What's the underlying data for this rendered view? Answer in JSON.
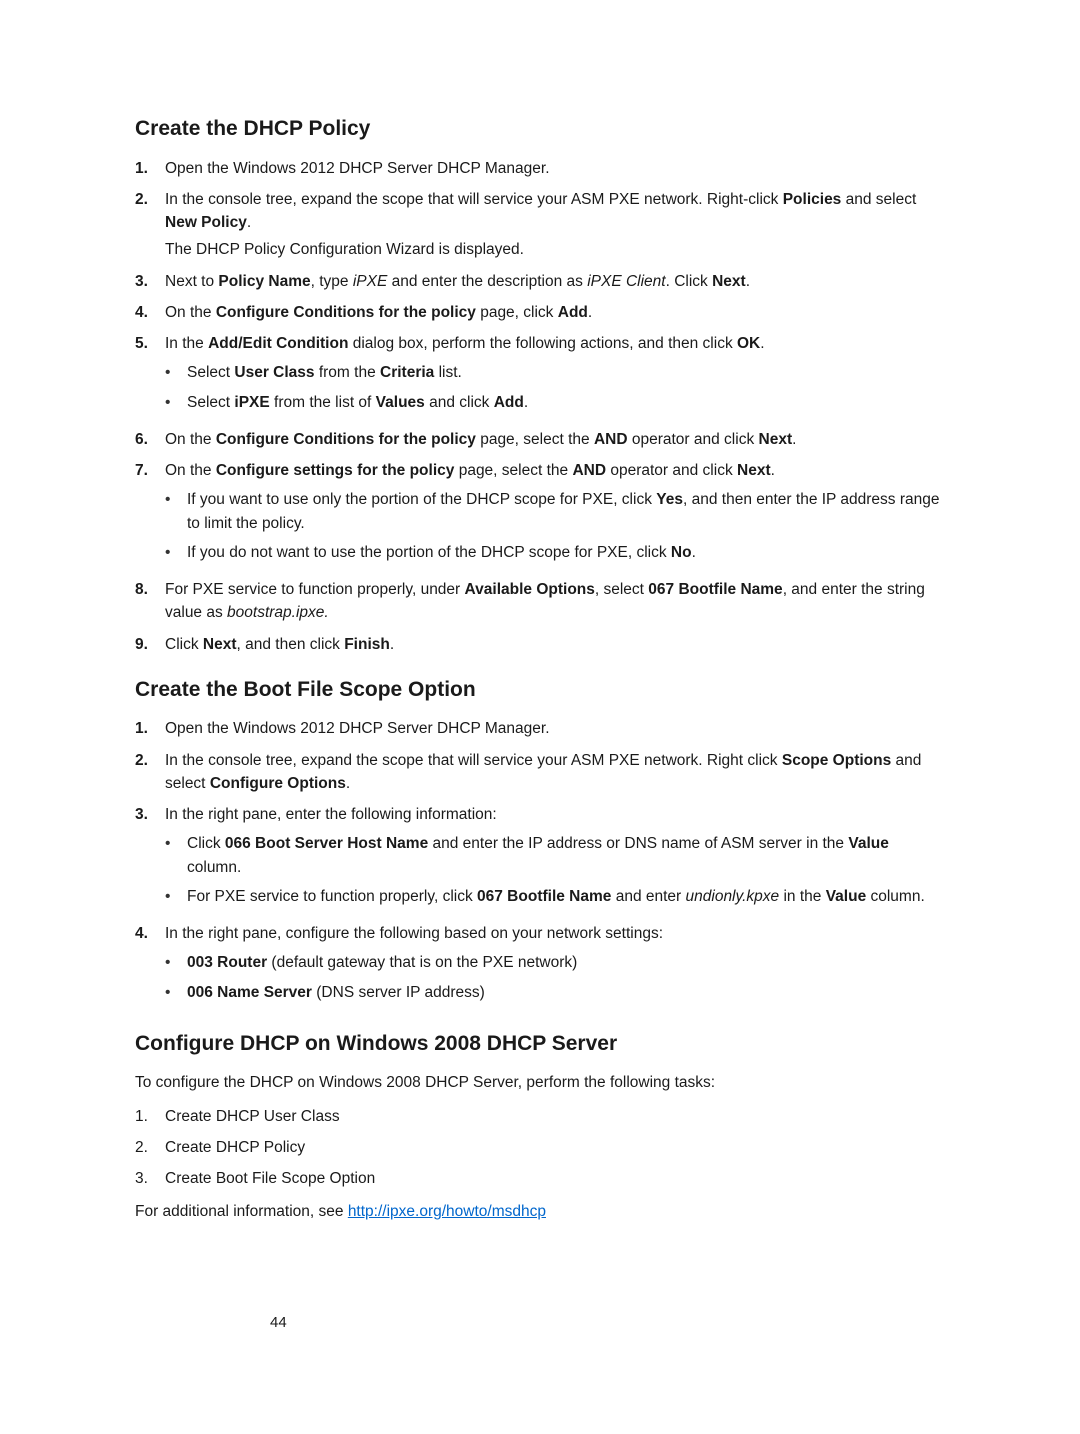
{
  "section1": {
    "heading": "Create the DHCP Policy",
    "items": [
      {
        "num": "1.",
        "html": "Open the Windows 2012 DHCP Server DHCP Manager."
      },
      {
        "num": "2.",
        "html": "In the console tree, expand the scope that will service your ASM PXE network. Right-click <b>Policies</b> and select <b>New Policy</b>.",
        "sub": "The DHCP Policy Configuration Wizard is displayed."
      },
      {
        "num": "3.",
        "html": "Next to <b>Policy Name</b>, type <i>iPXE</i> and enter the description as <i>iPXE Client</i>. Click <b>Next</b>."
      },
      {
        "num": "4.",
        "html": "On the <b>Configure Conditions for the policy</b> page, click <b>Add</b>."
      },
      {
        "num": "5.",
        "html": "In the <b>Add/Edit Condition</b> dialog box, perform the following actions, and then click <b>OK</b>.",
        "bullets": [
          "Select <b>User Class</b> from the <b>Criteria</b> list.",
          "Select <b>iPXE</b> from the list of <b>Values</b> and click <b>Add</b>."
        ]
      },
      {
        "num": "6.",
        "html": "On the <b>Configure Conditions for the policy</b> page, select the <b>AND</b> operator and click <b>Next</b>."
      },
      {
        "num": "7.",
        "html": "On the <b>Configure settings for the policy</b> page, select the <b>AND</b> operator and click <b>Next</b>.",
        "bullets": [
          "If you want to use only the portion of the DHCP scope for PXE, click <b>Yes</b>, and then enter the IP address range to limit the policy.",
          "If you do not want to use the portion of the DHCP scope for PXE, click <b>No</b>."
        ]
      },
      {
        "num": "8.",
        "html": "For PXE service to function properly, under <b>Available Options</b>, select <b>067 Bootfile Name</b>, and enter the string value as <i>bootstrap.ipxe.</i>"
      },
      {
        "num": "9.",
        "html": "Click <b>Next</b>, and then click <b>Finish</b>."
      }
    ]
  },
  "section2": {
    "heading": "Create the Boot File Scope Option",
    "items": [
      {
        "num": "1.",
        "html": "Open the Windows 2012 DHCP Server DHCP Manager."
      },
      {
        "num": "2.",
        "html": "In the console tree, expand the scope that will service your ASM PXE network. Right click <b>Scope Options</b> and select <b>Configure Options</b>."
      },
      {
        "num": "3.",
        "html": "In the right pane, enter the following information:",
        "bullets": [
          "Click <b>066 Boot Server Host Name</b> and enter the IP address or DNS name of ASM server in the <b>Value</b> column.",
          "For PXE service to function properly, click <b>067 Bootfile Name</b> and enter <i>undionly.kpxe</i> in the <b>Value</b> column."
        ]
      },
      {
        "num": "4.",
        "html": "In the right pane, configure the following based on your network settings:",
        "bullets": [
          "<b>003 Router</b> (default gateway that is on the PXE network)",
          "<b>006 Name Server</b> (DNS server IP address)"
        ]
      }
    ]
  },
  "section3": {
    "heading": "Configure DHCP on Windows 2008 DHCP Server",
    "intro": "To configure the DHCP on Windows 2008 DHCP Server, perform the following tasks:",
    "items": [
      {
        "num": "1.",
        "html": "Create DHCP User Class"
      },
      {
        "num": "2.",
        "html": "Create DHCP Policy"
      },
      {
        "num": "3.",
        "html": "Create Boot File Scope Option"
      }
    ],
    "footer_prefix": "For additional information, see ",
    "footer_link_text": "http://ipxe.org/howto/msdhcp"
  },
  "pageNumber": "44"
}
